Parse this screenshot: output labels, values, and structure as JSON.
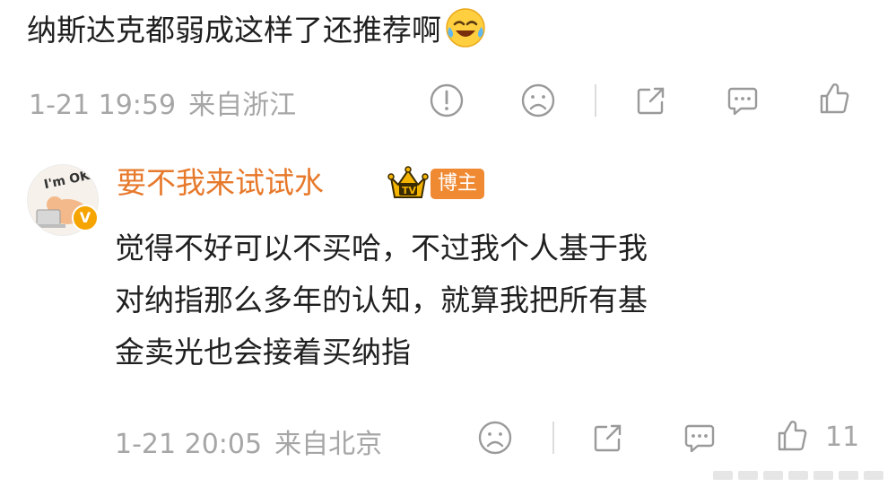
{
  "post": {
    "text": "纳斯达克都弱成这样了还推荐啊",
    "emoji": "laugh-cry-emoji"
  },
  "post_meta": {
    "time": "1-21 19:59",
    "source": "来自浙江",
    "actions": [
      "report-icon",
      "dislike-icon",
      "share-icon",
      "comment-icon",
      "like-icon"
    ]
  },
  "reply": {
    "username": "要不我来试试水",
    "badge": "博主",
    "avatar_text": "I'm OK!",
    "verified_mark": "V",
    "lines": [
      "觉得不好可以不买哈，不过我个人基于我",
      "对纳指那么多年的认知，就算我把所有基",
      "金卖光也会接着买纳指"
    ],
    "time": "1-21 20:05",
    "source": "来自北京",
    "like_count": "11"
  },
  "colors": {
    "username": "#e7792b",
    "badge_bg": "#f08a32",
    "meta_gray": "#a6a6a6",
    "verified": "#f5a400"
  }
}
